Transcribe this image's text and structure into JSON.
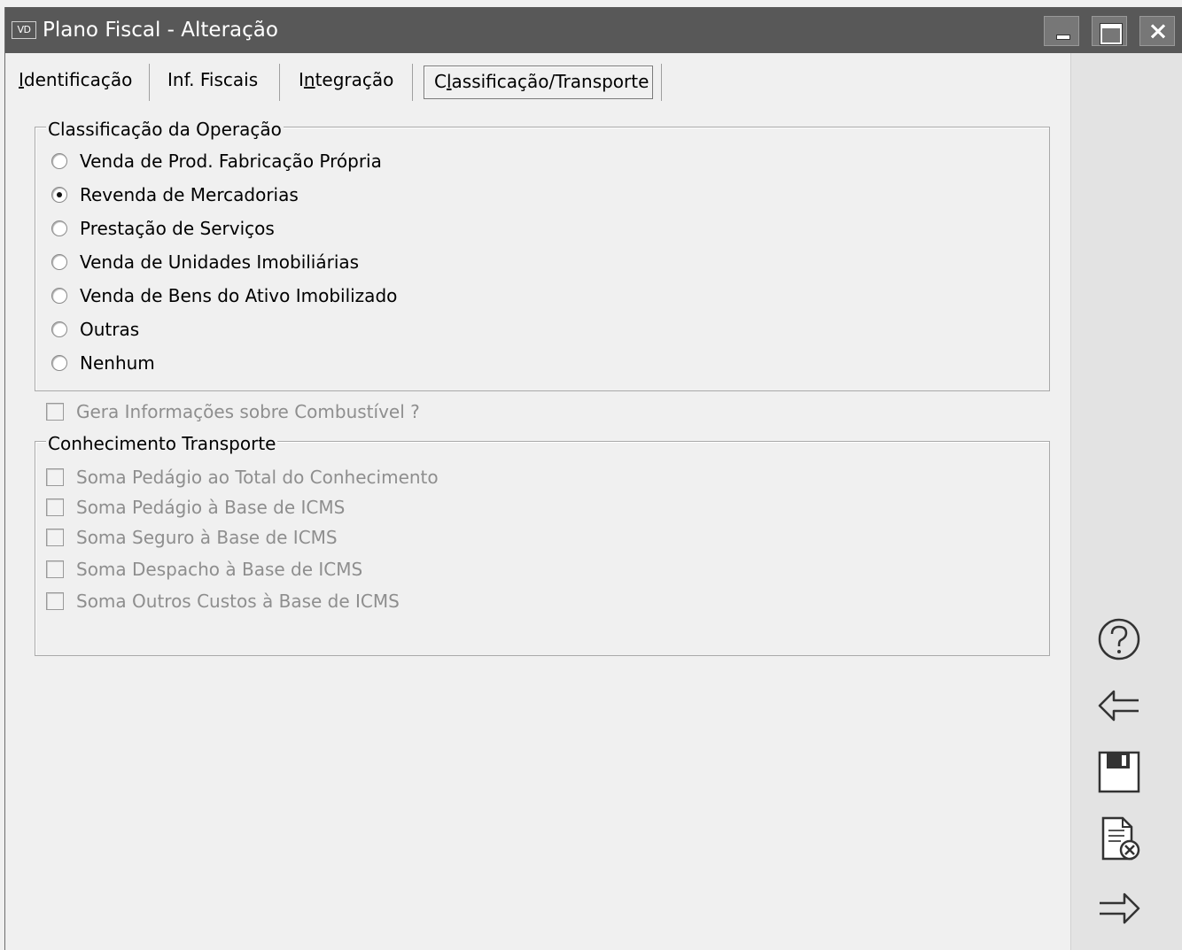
{
  "window": {
    "app_icon": "VD",
    "title": "Plano Fiscal - Alteração",
    "buttons": [
      "minimize",
      "maximize",
      "close"
    ]
  },
  "tabs": [
    {
      "label": "Identificação",
      "mnemonic": "I",
      "active": false
    },
    {
      "label": "Inf. Fiscais",
      "active": false
    },
    {
      "label": "Integração",
      "mnemonic": "n",
      "active": false
    },
    {
      "label": "Classificação/Transporte",
      "mnemonic": "l",
      "active": true
    }
  ],
  "classificacao": {
    "legend": "Classificação da Operação",
    "options": [
      {
        "label": "Venda de Prod. Fabricação Própria",
        "checked": false
      },
      {
        "label": "Revenda de Mercadorias",
        "checked": true
      },
      {
        "label": "Prestação de Serviços",
        "checked": false
      },
      {
        "label": "Venda de Unidades Imobiliárias",
        "checked": false
      },
      {
        "label": "Venda de Bens do Ativo Imobilizado",
        "checked": false
      },
      {
        "label": "Outras",
        "checked": false
      },
      {
        "label": "Nenhum",
        "checked": false
      }
    ]
  },
  "combustivel": {
    "label": "Gera Informações sobre Combustível ?",
    "checked": false,
    "enabled": false
  },
  "transporte": {
    "legend": "Conhecimento Transporte",
    "options": [
      {
        "label": "Soma Pedágio ao Total do Conhecimento",
        "checked": false,
        "enabled": false
      },
      {
        "label": "Soma Pedágio à Base de ICMS",
        "checked": false,
        "enabled": false
      },
      {
        "label": "Soma Seguro à Base de ICMS",
        "checked": false,
        "enabled": false
      },
      {
        "label": "Soma Despacho à Base de ICMS",
        "checked": false,
        "enabled": false
      },
      {
        "label": "Soma Outros Custos à Base de ICMS",
        "checked": false,
        "enabled": false
      }
    ]
  },
  "side_actions": [
    {
      "name": "help-icon"
    },
    {
      "name": "back-arrow-icon"
    },
    {
      "name": "save-icon"
    },
    {
      "name": "cancel-document-icon"
    },
    {
      "name": "forward-arrow-icon"
    }
  ],
  "colors": {
    "titlebar": "#585858",
    "background": "#f0f0f0",
    "sidepanel": "#e3e3e3",
    "disabled_text": "#8e8e8e"
  }
}
